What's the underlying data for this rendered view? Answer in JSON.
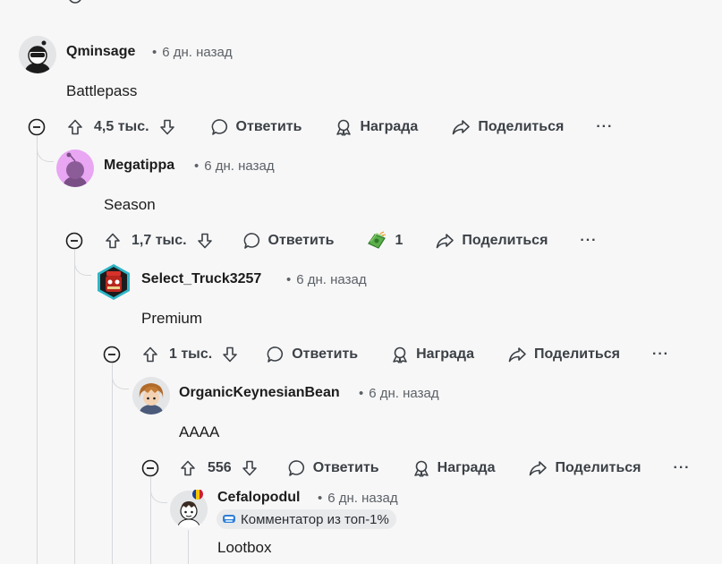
{
  "comments": [
    {
      "username": "Qminsage",
      "time": "6 дн. назад",
      "text": "Battlepass",
      "votes": "4,5 тыс.",
      "reply": "Ответить",
      "award": "Награда",
      "share": "Поделиться",
      "more": "···"
    },
    {
      "username": "Megatippa",
      "time": "6 дн. назад",
      "text": "Season",
      "votes": "1,7 тыс.",
      "reply": "Ответить",
      "award_count": "1",
      "share": "Поделиться",
      "more": "···"
    },
    {
      "username": "Select_Truck3257",
      "time": "6 дн. назад",
      "text": "Premium",
      "votes": "1 тыс.",
      "reply": "Ответить",
      "award": "Награда",
      "share": "Поделиться",
      "more": "···"
    },
    {
      "username": "OrganicKeynesianBean",
      "time": "6 дн. назад",
      "text": "AAAA",
      "votes": "556",
      "reply": "Ответить",
      "award": "Награда",
      "share": "Поделиться",
      "more": "···"
    },
    {
      "username": "Cefalopodul",
      "time": "6 дн. назад",
      "flair": "Комментатор из топ-1%",
      "text": "Lootbox"
    }
  ],
  "separator": "•",
  "colors": {
    "background": "#f7f7f8",
    "thread_line": "#d6d8db",
    "meta_text": "#5c6166",
    "action_text": "#3c4146"
  }
}
